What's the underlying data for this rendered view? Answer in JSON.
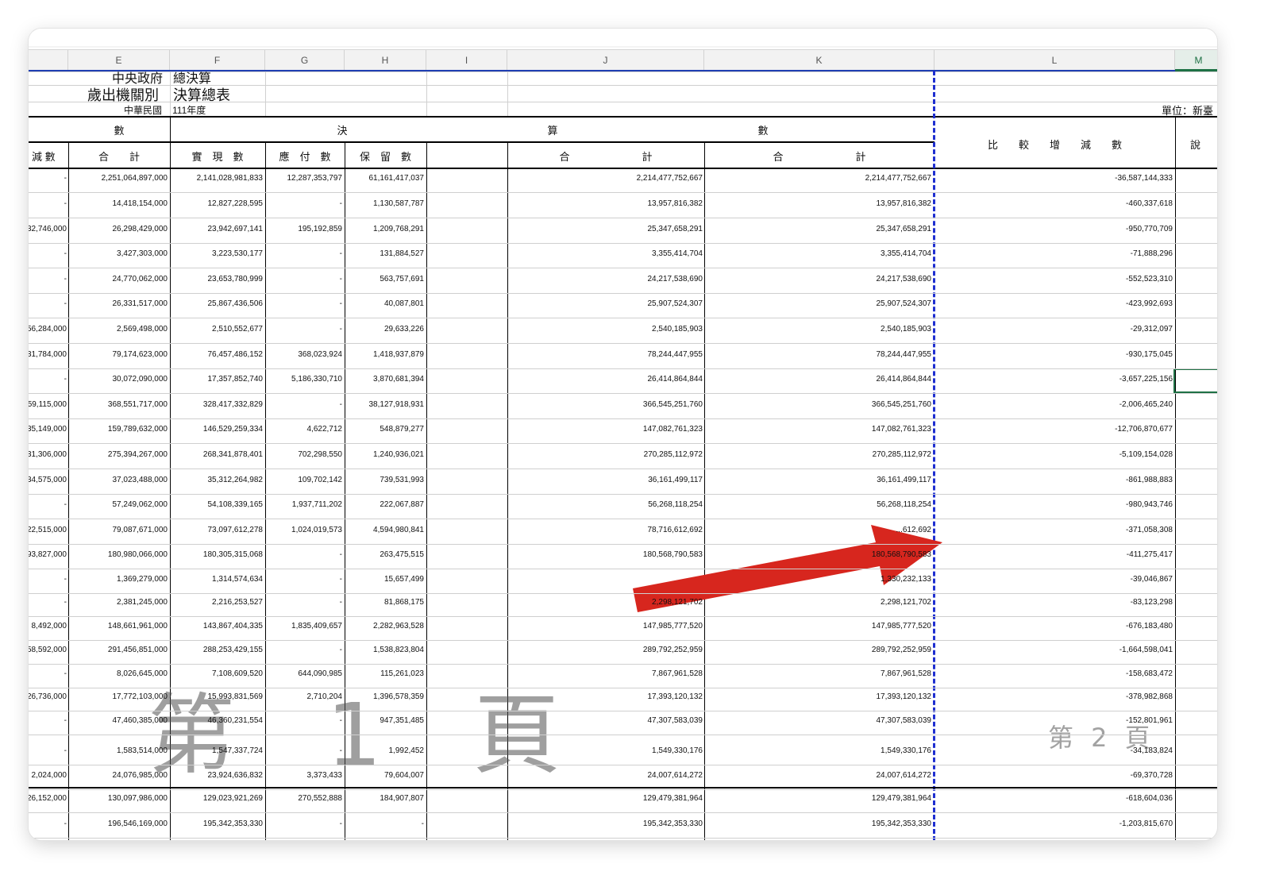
{
  "column_headers": [
    "E",
    "F",
    "G",
    "H",
    "I",
    "J",
    "K",
    "L",
    "M"
  ],
  "selected_column": "M",
  "title": {
    "line1_left": "中央政府",
    "line1_right": "總決算",
    "line2_left": "歲出機關別",
    "line2_right": "決算總表",
    "line3_left": "中華民國",
    "line3_right": "111年度",
    "unit": "單位：新臺"
  },
  "group_headers": {
    "shu": "數",
    "jue": "決",
    "suan": "算",
    "shu2": "數",
    "compare": "比　　較　　增　　減　　數",
    "note": "說"
  },
  "sub_headers": {
    "minus": "減 數",
    "total1": "合　　計",
    "realized": "實　現　數",
    "payable": "應　付　數",
    "reserved": "保　留　數",
    "total2": "合　　　　　　　計",
    "total3": "合　　　　　　　計"
  },
  "rows": [
    {
      "e": "-",
      "f": "2,251,064,897,000",
      "g": "2,141,028,981,833",
      "h": "12,287,353,797",
      "i": "61,161,417,037",
      "j": "2,214,477,752,667",
      "k": "2,214,477,752,667",
      "l": "-36,587,144,333"
    },
    {
      "e": "-",
      "f": "14,418,154,000",
      "g": "12,827,228,595",
      "h": "-",
      "i": "1,130,587,787",
      "j": "13,957,816,382",
      "k": "13,957,816,382",
      "l": "-460,337,618"
    },
    {
      "e": "32,746,000",
      "f": "26,298,429,000",
      "g": "23,942,697,141",
      "h": "195,192,859",
      "i": "1,209,768,291",
      "j": "25,347,658,291",
      "k": "25,347,658,291",
      "l": "-950,770,709"
    },
    {
      "e": "-",
      "f": "3,427,303,000",
      "g": "3,223,530,177",
      "h": "-",
      "i": "131,884,527",
      "j": "3,355,414,704",
      "k": "3,355,414,704",
      "l": "-71,888,296"
    },
    {
      "e": "-",
      "f": "24,770,062,000",
      "g": "23,653,780,999",
      "h": "-",
      "i": "563,757,691",
      "j": "24,217,538,690",
      "k": "24,217,538,690",
      "l": "-552,523,310"
    },
    {
      "e": "-",
      "f": "26,331,517,000",
      "g": "25,867,436,506",
      "h": "-",
      "i": "40,087,801",
      "j": "25,907,524,307",
      "k": "25,907,524,307",
      "l": "-423,992,693"
    },
    {
      "e": "56,284,000",
      "f": "2,569,498,000",
      "g": "2,510,552,677",
      "h": "-",
      "i": "29,633,226",
      "j": "2,540,185,903",
      "k": "2,540,185,903",
      "l": "-29,312,097"
    },
    {
      "e": "31,784,000",
      "f": "79,174,623,000",
      "g": "76,457,486,152",
      "h": "368,023,924",
      "i": "1,418,937,879",
      "j": "78,244,447,955",
      "k": "78,244,447,955",
      "l": "-930,175,045"
    },
    {
      "e": "-",
      "f": "30,072,090,000",
      "g": "17,357,852,740",
      "h": "5,186,330,710",
      "i": "3,870,681,394",
      "j": "26,414,864,844",
      "k": "26,414,864,844",
      "l": "-3,657,225,156"
    },
    {
      "e": "59,115,000",
      "f": "368,551,717,000",
      "g": "328,417,332,829",
      "h": "-",
      "i": "38,127,918,931",
      "j": "366,545,251,760",
      "k": "366,545,251,760",
      "l": "-2,006,465,240"
    },
    {
      "e": "35,149,000",
      "f": "159,789,632,000",
      "g": "146,529,259,334",
      "h": "4,622,712",
      "i": "548,879,277",
      "j": "147,082,761,323",
      "k": "147,082,761,323",
      "l": "-12,706,870,677"
    },
    {
      "e": "31,306,000",
      "f": "275,394,267,000",
      "g": "268,341,878,401",
      "h": "702,298,550",
      "i": "1,240,936,021",
      "j": "270,285,112,972",
      "k": "270,285,112,972",
      "l": "-5,109,154,028"
    },
    {
      "e": "34,575,000",
      "f": "37,023,488,000",
      "g": "35,312,264,982",
      "h": "109,702,142",
      "i": "739,531,993",
      "j": "36,161,499,117",
      "k": "36,161,499,117",
      "l": "-861,988,883"
    },
    {
      "e": "-",
      "f": "57,249,062,000",
      "g": "54,108,339,165",
      "h": "1,937,711,202",
      "i": "222,067,887",
      "j": "56,268,118,254",
      "k": "56,268,118,254",
      "l": "-980,943,746"
    },
    {
      "e": "22,515,000",
      "f": "79,087,671,000",
      "g": "73,097,612,278",
      "h": "1,024,019,573",
      "i": "4,594,980,841",
      "j": "78,716,612,692",
      "k": "...612,692",
      "l": "-371,058,308"
    },
    {
      "e": "93,827,000",
      "f": "180,980,066,000",
      "g": "180,305,315,068",
      "h": "-",
      "i": "263,475,515",
      "j": "180,568,790,583",
      "k": "180,568,790,583",
      "l": "-411,275,417"
    },
    {
      "e": "-",
      "f": "1,369,279,000",
      "g": "1,314,574,634",
      "h": "-",
      "i": "15,657,499",
      "j": "",
      "k": "1,330,232,133",
      "l": "-39,046,867"
    },
    {
      "e": "-",
      "f": "2,381,245,000",
      "g": "2,216,253,527",
      "h": "-",
      "i": "81,868,175",
      "j": "2,298,121,702",
      "k": "2,298,121,702",
      "l": "-83,123,298"
    },
    {
      "e": "8,492,000",
      "f": "148,661,961,000",
      "g": "143,867,404,335",
      "h": "1,835,409,657",
      "i": "2,282,963,528",
      "j": "147,985,777,520",
      "k": "147,985,777,520",
      "l": "-676,183,480"
    },
    {
      "e": "58,592,000",
      "f": "291,456,851,000",
      "g": "288,253,429,155",
      "h": "-",
      "i": "1,538,823,804",
      "j": "289,792,252,959",
      "k": "289,792,252,959",
      "l": "-1,664,598,041"
    },
    {
      "e": "-",
      "f": "8,026,645,000",
      "g": "7,108,609,520",
      "h": "644,090,985",
      "i": "115,261,023",
      "j": "7,867,961,528",
      "k": "7,867,961,528",
      "l": "-158,683,472"
    },
    {
      "e": "26,736,000",
      "f": "17,772,103,000",
      "g": "15,993,831,569",
      "h": "2,710,204",
      "i": "1,396,578,359",
      "j": "17,393,120,132",
      "k": "17,393,120,132",
      "l": "-378,982,868"
    },
    {
      "e": "-",
      "f": "47,460,385,000",
      "g": "46,360,231,554",
      "h": "-",
      "i": "947,351,485",
      "j": "47,307,583,039",
      "k": "47,307,583,039",
      "l": "-152,801,961"
    },
    {
      "e": "-",
      "f": "1,583,514,000",
      "g": "1,547,337,724",
      "h": "-",
      "i": "1,992,452",
      "j": "1,549,330,176",
      "k": "1,549,330,176",
      "l": "-34,183,824"
    },
    {
      "e": "2,024,000",
      "f": "24,076,985,000",
      "g": "23,924,636,832",
      "h": "3,373,433",
      "i": "79,604,007",
      "j": "24,007,614,272",
      "k": "24,007,614,272",
      "l": "-69,370,728"
    },
    {
      "e": "26,152,000",
      "f": "130,097,986,000",
      "g": "129,023,921,269",
      "h": "270,552,888",
      "i": "184,907,807",
      "j": "129,479,381,964",
      "k": "129,479,381,964",
      "l": "-618,604,036"
    },
    {
      "e": "-",
      "f": "196,546,169,000",
      "g": "195,342,353,330",
      "h": "-",
      "i": "-",
      "j": "195,342,353,330",
      "k": "195,342,353,330",
      "l": "-1,203,815,670"
    }
  ],
  "watermark_page1": "第 1 頁",
  "watermark_page2": "第 2 頁",
  "arrow_color": "#d7261e"
}
